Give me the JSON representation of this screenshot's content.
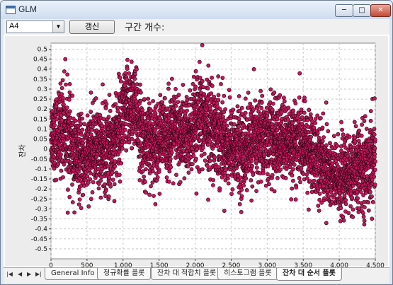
{
  "window": {
    "title": "GLM",
    "minimize": "─",
    "maximize": "□",
    "close": "✕"
  },
  "toolbar": {
    "variable_select": "A4",
    "refresh_label": "갱신",
    "bins_label": "구간 개수:"
  },
  "chart_data": {
    "type": "scatter",
    "title": "",
    "xlabel": "",
    "ylabel": "잔차",
    "xlim": [
      0,
      4500
    ],
    "ylim": [
      -0.55,
      0.53
    ],
    "x_ticks": [
      0,
      500,
      1000,
      1500,
      2000,
      2500,
      3000,
      3500,
      4000,
      4500
    ],
    "x_tick_labels": [
      "0",
      "500",
      "1,000",
      "1,500",
      "2,000",
      "2,500",
      "3,000",
      "3,500",
      "4,000",
      "4,500"
    ],
    "y_ticks": [
      0.5,
      0.45,
      0.4,
      0.35,
      0.3,
      0.25,
      0.2,
      0.15,
      0.1,
      0.05,
      0,
      -0.05,
      -0.1,
      -0.15,
      -0.2,
      -0.25,
      -0.3,
      -0.35,
      -0.4,
      -0.45,
      -0.5
    ],
    "y_tick_labels": [
      "0.5",
      "0.45",
      "0.4",
      "0.35",
      "0.3",
      "0.25",
      "0.2",
      "0.15",
      "0.1",
      "0.05",
      "0",
      "-0.05",
      "-0.1",
      "-0.15",
      "-0.2",
      "-0.25",
      "-0.3",
      "-0.35",
      "-0.4",
      "-0.45",
      "-0.5"
    ],
    "grid": true,
    "marker_color": "#c2185b",
    "marker_edge": "#2a0010",
    "n_points": 4500,
    "profile": [
      [
        0,
        0.08,
        0.1
      ],
      [
        100,
        0.06,
        0.12
      ],
      [
        180,
        0.14,
        0.14
      ],
      [
        300,
        -0.02,
        0.12
      ],
      [
        450,
        -0.06,
        0.11
      ],
      [
        600,
        0.02,
        0.11
      ],
      [
        800,
        -0.02,
        0.13
      ],
      [
        950,
        0.12,
        0.13
      ],
      [
        1050,
        0.2,
        0.13
      ],
      [
        1150,
        0.22,
        0.12
      ],
      [
        1300,
        0.02,
        0.12
      ],
      [
        1500,
        0.05,
        0.11
      ],
      [
        1700,
        0.08,
        0.12
      ],
      [
        1900,
        0.06,
        0.12
      ],
      [
        2100,
        0.15,
        0.14
      ],
      [
        2300,
        0.1,
        0.13
      ],
      [
        2450,
        0.02,
        0.12
      ],
      [
        2650,
        -0.01,
        0.12
      ],
      [
        2900,
        0.06,
        0.12
      ],
      [
        3100,
        0.04,
        0.12
      ],
      [
        3300,
        0.04,
        0.11
      ],
      [
        3500,
        0.02,
        0.11
      ],
      [
        3750,
        -0.06,
        0.12
      ],
      [
        3950,
        -0.16,
        0.11
      ],
      [
        4150,
        -0.12,
        0.11
      ],
      [
        4350,
        -0.1,
        0.12
      ],
      [
        4500,
        -0.03,
        0.13
      ]
    ]
  },
  "tabs": [
    {
      "label": "General Info"
    },
    {
      "label": "정규확률 플롯"
    },
    {
      "label": "잔차 대 적합치 플롯"
    },
    {
      "label": "히스토그램 플롯"
    },
    {
      "label": "잔차 대 순서 플롯"
    }
  ],
  "nav": {
    "first": "|◀",
    "prev": "◀",
    "next": "▶",
    "last": "▶|"
  }
}
